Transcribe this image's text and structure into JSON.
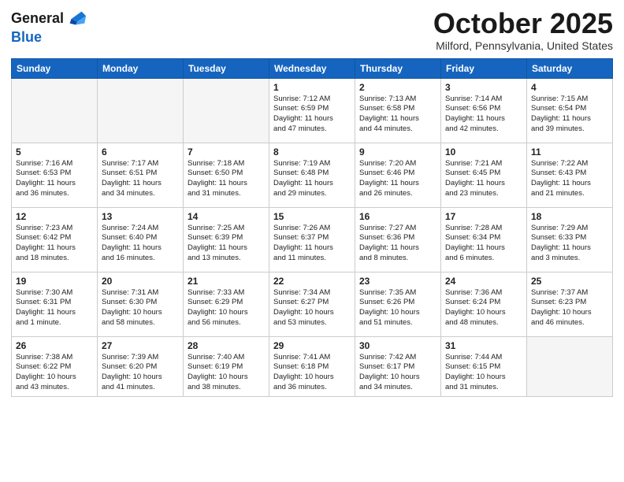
{
  "header": {
    "logo_general": "General",
    "logo_blue": "Blue",
    "month_title": "October 2025",
    "location": "Milford, Pennsylvania, United States"
  },
  "weekdays": [
    "Sunday",
    "Monday",
    "Tuesday",
    "Wednesday",
    "Thursday",
    "Friday",
    "Saturday"
  ],
  "weeks": [
    [
      {
        "day": "",
        "info": ""
      },
      {
        "day": "",
        "info": ""
      },
      {
        "day": "",
        "info": ""
      },
      {
        "day": "1",
        "info": "Sunrise: 7:12 AM\nSunset: 6:59 PM\nDaylight: 11 hours\nand 47 minutes."
      },
      {
        "day": "2",
        "info": "Sunrise: 7:13 AM\nSunset: 6:58 PM\nDaylight: 11 hours\nand 44 minutes."
      },
      {
        "day": "3",
        "info": "Sunrise: 7:14 AM\nSunset: 6:56 PM\nDaylight: 11 hours\nand 42 minutes."
      },
      {
        "day": "4",
        "info": "Sunrise: 7:15 AM\nSunset: 6:54 PM\nDaylight: 11 hours\nand 39 minutes."
      }
    ],
    [
      {
        "day": "5",
        "info": "Sunrise: 7:16 AM\nSunset: 6:53 PM\nDaylight: 11 hours\nand 36 minutes."
      },
      {
        "day": "6",
        "info": "Sunrise: 7:17 AM\nSunset: 6:51 PM\nDaylight: 11 hours\nand 34 minutes."
      },
      {
        "day": "7",
        "info": "Sunrise: 7:18 AM\nSunset: 6:50 PM\nDaylight: 11 hours\nand 31 minutes."
      },
      {
        "day": "8",
        "info": "Sunrise: 7:19 AM\nSunset: 6:48 PM\nDaylight: 11 hours\nand 29 minutes."
      },
      {
        "day": "9",
        "info": "Sunrise: 7:20 AM\nSunset: 6:46 PM\nDaylight: 11 hours\nand 26 minutes."
      },
      {
        "day": "10",
        "info": "Sunrise: 7:21 AM\nSunset: 6:45 PM\nDaylight: 11 hours\nand 23 minutes."
      },
      {
        "day": "11",
        "info": "Sunrise: 7:22 AM\nSunset: 6:43 PM\nDaylight: 11 hours\nand 21 minutes."
      }
    ],
    [
      {
        "day": "12",
        "info": "Sunrise: 7:23 AM\nSunset: 6:42 PM\nDaylight: 11 hours\nand 18 minutes."
      },
      {
        "day": "13",
        "info": "Sunrise: 7:24 AM\nSunset: 6:40 PM\nDaylight: 11 hours\nand 16 minutes."
      },
      {
        "day": "14",
        "info": "Sunrise: 7:25 AM\nSunset: 6:39 PM\nDaylight: 11 hours\nand 13 minutes."
      },
      {
        "day": "15",
        "info": "Sunrise: 7:26 AM\nSunset: 6:37 PM\nDaylight: 11 hours\nand 11 minutes."
      },
      {
        "day": "16",
        "info": "Sunrise: 7:27 AM\nSunset: 6:36 PM\nDaylight: 11 hours\nand 8 minutes."
      },
      {
        "day": "17",
        "info": "Sunrise: 7:28 AM\nSunset: 6:34 PM\nDaylight: 11 hours\nand 6 minutes."
      },
      {
        "day": "18",
        "info": "Sunrise: 7:29 AM\nSunset: 6:33 PM\nDaylight: 11 hours\nand 3 minutes."
      }
    ],
    [
      {
        "day": "19",
        "info": "Sunrise: 7:30 AM\nSunset: 6:31 PM\nDaylight: 11 hours\nand 1 minute."
      },
      {
        "day": "20",
        "info": "Sunrise: 7:31 AM\nSunset: 6:30 PM\nDaylight: 10 hours\nand 58 minutes."
      },
      {
        "day": "21",
        "info": "Sunrise: 7:33 AM\nSunset: 6:29 PM\nDaylight: 10 hours\nand 56 minutes."
      },
      {
        "day": "22",
        "info": "Sunrise: 7:34 AM\nSunset: 6:27 PM\nDaylight: 10 hours\nand 53 minutes."
      },
      {
        "day": "23",
        "info": "Sunrise: 7:35 AM\nSunset: 6:26 PM\nDaylight: 10 hours\nand 51 minutes."
      },
      {
        "day": "24",
        "info": "Sunrise: 7:36 AM\nSunset: 6:24 PM\nDaylight: 10 hours\nand 48 minutes."
      },
      {
        "day": "25",
        "info": "Sunrise: 7:37 AM\nSunset: 6:23 PM\nDaylight: 10 hours\nand 46 minutes."
      }
    ],
    [
      {
        "day": "26",
        "info": "Sunrise: 7:38 AM\nSunset: 6:22 PM\nDaylight: 10 hours\nand 43 minutes."
      },
      {
        "day": "27",
        "info": "Sunrise: 7:39 AM\nSunset: 6:20 PM\nDaylight: 10 hours\nand 41 minutes."
      },
      {
        "day": "28",
        "info": "Sunrise: 7:40 AM\nSunset: 6:19 PM\nDaylight: 10 hours\nand 38 minutes."
      },
      {
        "day": "29",
        "info": "Sunrise: 7:41 AM\nSunset: 6:18 PM\nDaylight: 10 hours\nand 36 minutes."
      },
      {
        "day": "30",
        "info": "Sunrise: 7:42 AM\nSunset: 6:17 PM\nDaylight: 10 hours\nand 34 minutes."
      },
      {
        "day": "31",
        "info": "Sunrise: 7:44 AM\nSunset: 6:15 PM\nDaylight: 10 hours\nand 31 minutes."
      },
      {
        "day": "",
        "info": ""
      }
    ]
  ]
}
